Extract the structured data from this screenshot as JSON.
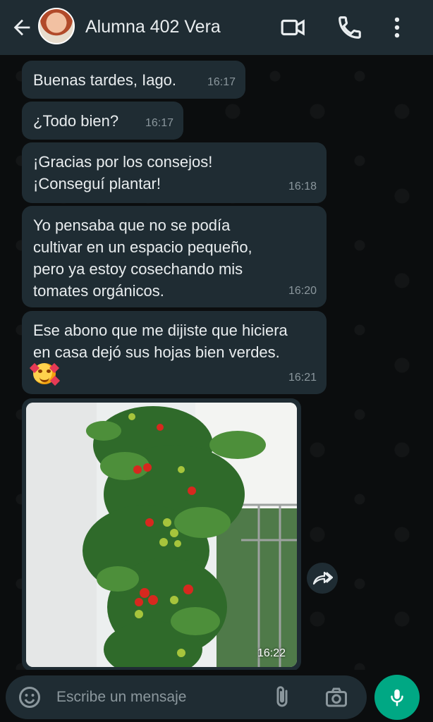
{
  "header": {
    "contact_name": "Alumna 402 Vera",
    "icons": [
      "back-arrow-icon",
      "video-call-icon",
      "phone-icon",
      "menu-icon"
    ]
  },
  "messages": [
    {
      "text": "Buenas tardes, Iago.",
      "time": "16:17"
    },
    {
      "text": "¿Todo bien?",
      "time": "16:17"
    },
    {
      "line1": "¡Gracias por los consejos!",
      "line2": "¡Conseguí plantar!",
      "time": "16:18"
    },
    {
      "line1": "Yo pensaba que no se podía",
      "line2": "cultivar en un espacio pequeño,",
      "line3": "pero ya estoy cosechando mis",
      "line4": "tomates orgánicos.",
      "time": "16:20"
    },
    {
      "line1": "Ese abono que me dijiste que hiciera",
      "line2": "en casa dejó sus hojas bien verdes.",
      "emoji": "smiling-face-with-hearts",
      "time": "16:21"
    },
    {
      "type": "image",
      "alt": "tomato plant",
      "time": "16:22"
    }
  ],
  "input": {
    "placeholder": "Escribe un mensaje",
    "icons": [
      "emoji-icon",
      "attach-icon",
      "camera-icon",
      "mic-icon"
    ]
  },
  "colors": {
    "header_bg": "#1f2c33",
    "bubble_bg": "#1f2c33",
    "chat_bg": "#0b0d0e",
    "accent": "#00a884",
    "time_text": "#8b979d"
  }
}
